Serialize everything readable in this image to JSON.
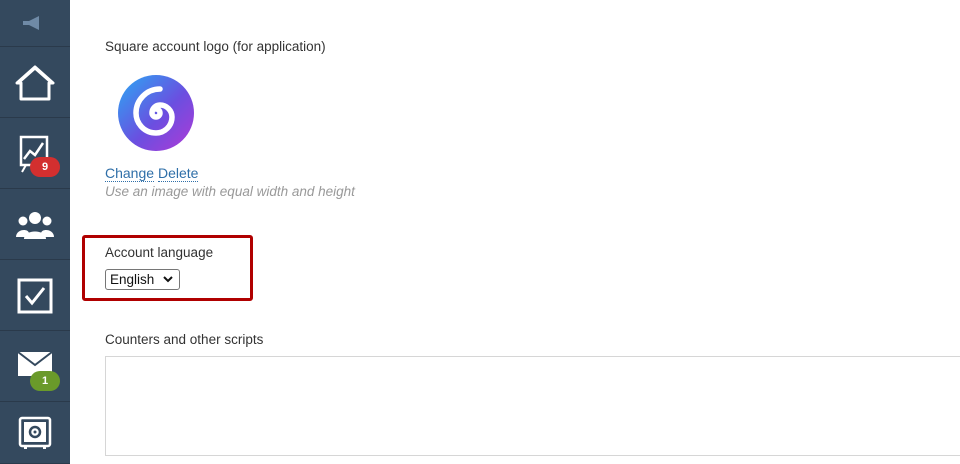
{
  "sidebar": {
    "items": [
      {
        "name": "announcements",
        "icon": "megaphone-icon"
      },
      {
        "name": "home",
        "icon": "home-icon"
      },
      {
        "name": "sales",
        "icon": "chart-icon",
        "badge": "9",
        "badge_color": "#d32f2f"
      },
      {
        "name": "contacts",
        "icon": "users-icon"
      },
      {
        "name": "tasks",
        "icon": "checkbox-icon"
      },
      {
        "name": "mail",
        "icon": "mail-icon",
        "badge": "1",
        "badge_color": "#6a9a2a"
      },
      {
        "name": "settings",
        "icon": "safe-gear-icon"
      }
    ],
    "background": "#34495e"
  },
  "logo_section": {
    "label": "Square account logo (for application)",
    "change_link": "Change",
    "delete_link": "Delete",
    "hint": "Use an image with equal width and height"
  },
  "language_section": {
    "label": "Account language",
    "selected": "English",
    "highlight_color": "#b00000"
  },
  "scripts_section": {
    "label": "Counters and other scripts",
    "value": ""
  }
}
